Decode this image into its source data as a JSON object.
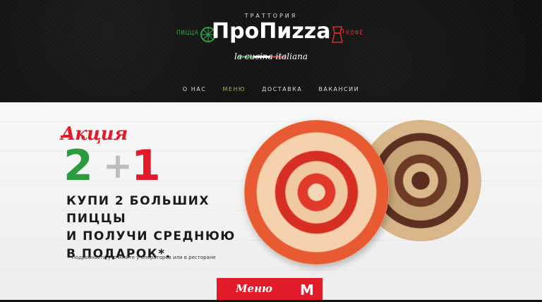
{
  "logo": {
    "trattoria": "ТРАТТОРИЯ",
    "brand": "ПроПиzza",
    "pizza_word": "ПИЦЦА",
    "coffee_word": "КОФЕ",
    "cucina": "la cucina italiana",
    "flag_colors": [
      "#2e9e4a",
      "#ffffff",
      "#d12b2b"
    ]
  },
  "nav": {
    "items": [
      {
        "label": "О НАС"
      },
      {
        "label": "МЕНЮ"
      },
      {
        "label": "ДОСТАВКА"
      },
      {
        "label": "ВАКАНСИИ"
      }
    ],
    "active_color": "#8bc34a"
  },
  "promo": {
    "akcia": "Акция",
    "num_two": "2",
    "plus": "+",
    "num_one": "1",
    "offer_lines": [
      "КУПИ 2 БОЛЬШИХ ПИЦЦЫ",
      "И ПОЛУЧИ СРЕДНЮЮ",
      "В ПОДАРОК*."
    ],
    "note": "* Подробности уточняйте у операторов или в ресторане",
    "colors": {
      "green": "#2b9b3d",
      "red": "#e21b2a",
      "grey": "#bdbdbd"
    }
  },
  "menu_button": {
    "label": "Меню",
    "partial_label": "М"
  }
}
